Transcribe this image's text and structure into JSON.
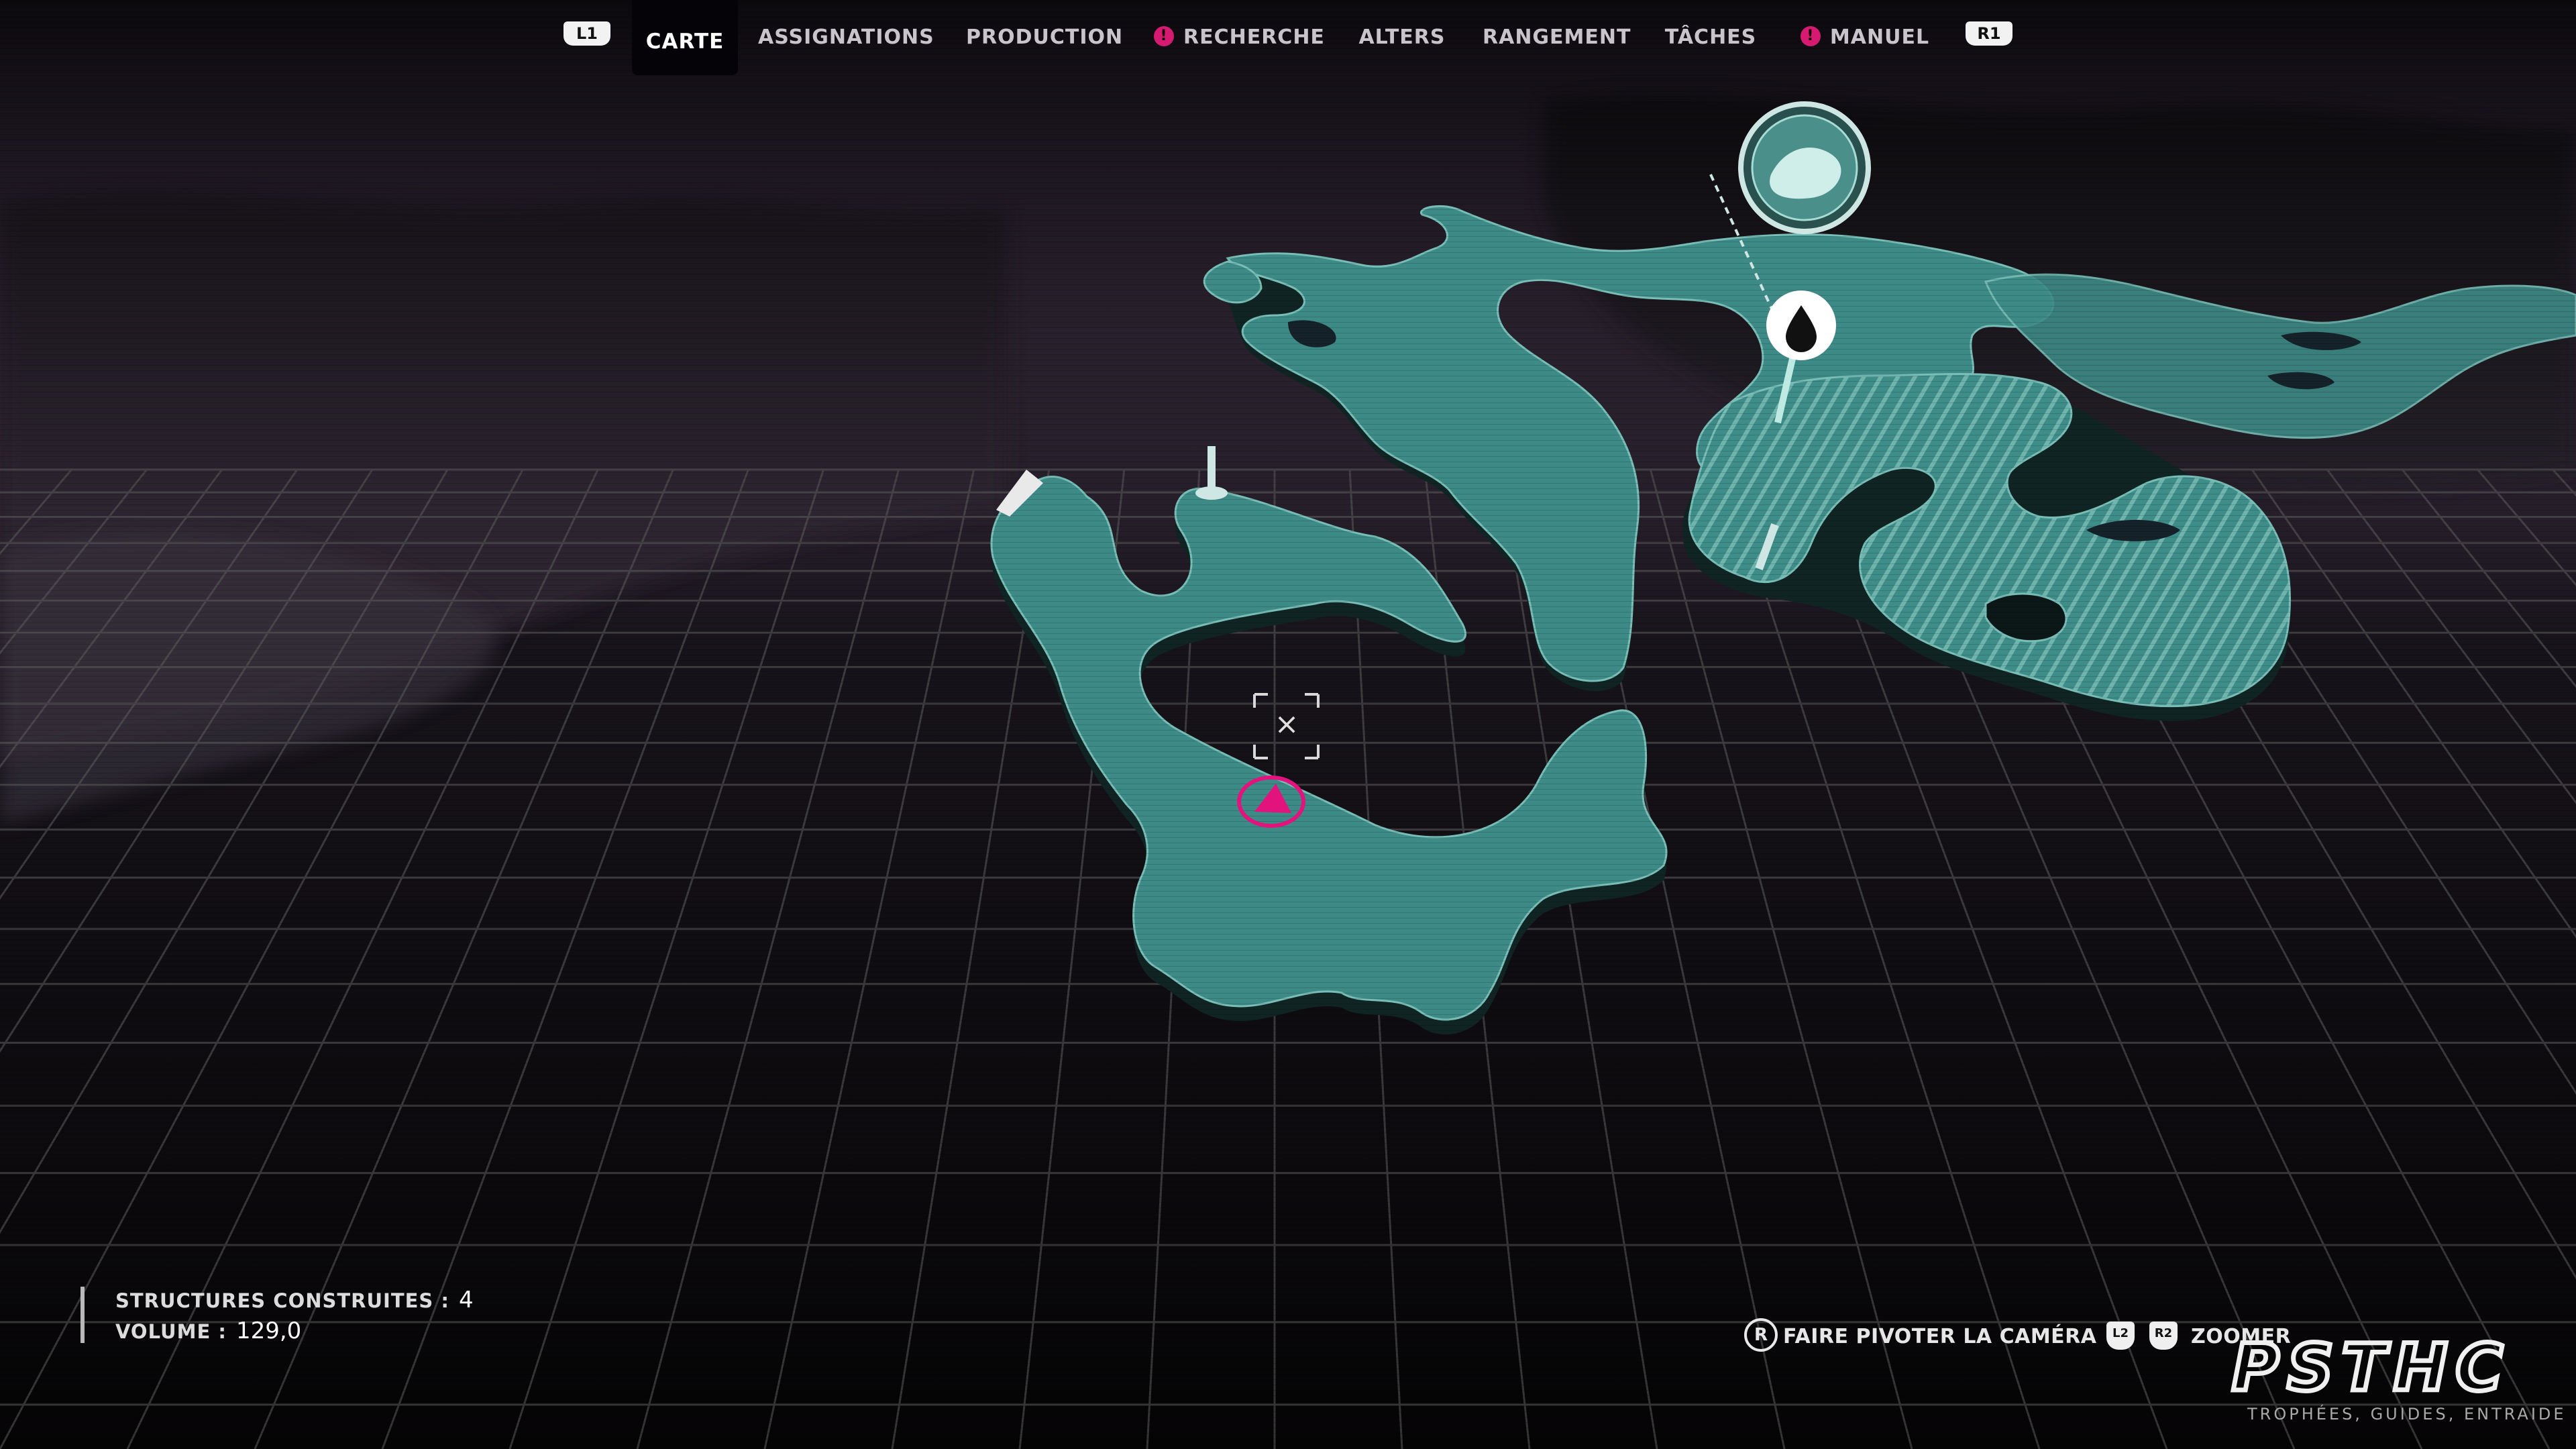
{
  "tabs": {
    "left_bumper": "L1",
    "right_bumper": "R1",
    "items": [
      {
        "label": "CARTE",
        "alert": false,
        "active": true
      },
      {
        "label": "ASSIGNATIONS",
        "alert": false,
        "active": false
      },
      {
        "label": "PRODUCTION",
        "alert": false,
        "active": false
      },
      {
        "label": "RECHERCHE",
        "alert": true,
        "active": false
      },
      {
        "label": "ALTERS",
        "alert": false,
        "active": false
      },
      {
        "label": "RANGEMENT",
        "alert": false,
        "active": false
      },
      {
        "label": "TÂCHES",
        "alert": false,
        "active": false
      },
      {
        "label": "MANUEL",
        "alert": true,
        "active": false
      }
    ],
    "alert_glyph": "!"
  },
  "stats": {
    "structures_label": "STRUCTURES CONSTRUITES :",
    "structures_value": "4",
    "volume_label": "VOLUME :",
    "volume_value": "129,0"
  },
  "controls": {
    "rotate_button": "R",
    "rotate_label": "FAIRE PIVOTER LA CAMÉRA",
    "zoom_buttons": [
      "L2",
      "R2"
    ],
    "zoom_label": "ZOOMER"
  },
  "watermark": {
    "logo": "PSTHC",
    "tagline": "TROPHÉES, GUIDES, ENTRAIDE"
  },
  "map": {
    "cursor_glyph": "×",
    "icons": [
      "resource-droplet-icon",
      "player-marker-icon",
      "base-pin-icon",
      "structure-marker-icon"
    ]
  },
  "colors": {
    "island_fill": "#3d8a86",
    "island_stripes": "#5aa39e",
    "island_edge": "#0f2524",
    "player_marker": "#e3137d",
    "sky_top": "#4c3c57",
    "grid_line": "#6a6a6a"
  }
}
